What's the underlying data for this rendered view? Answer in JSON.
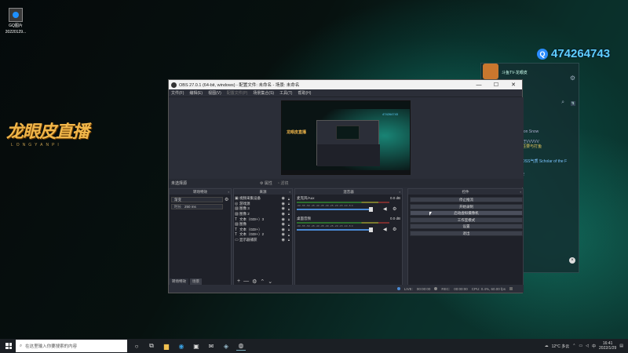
{
  "desktop": {
    "icon_label_line1": "GQ图片",
    "icon_label_line2": "20220129...",
    "logo_main": "龙眼皮直播",
    "logo_sub": "LONGYANPI",
    "qq_number": "474264743"
  },
  "chat_panel": {
    "title": "斗鱼TV-龙眼皮",
    "lines": [
      {
        "text": "...ron Snow",
        "style": "normal"
      },
      {
        "text": "...旺VVVVV",
        "style": "normal"
      },
      {
        "text": "...任要与打鱼",
        "style": "yellow"
      },
      {
        "text": "...DSS气质 Scholar of the F",
        "style": "blue"
      },
      {
        "text": "...2",
        "style": "normal"
      }
    ]
  },
  "obs": {
    "title": "OBS 27.0.1 (64-bit, windows) - 配置文件: 未命名 - 场景: 未命名",
    "menu": [
      {
        "label": "文件(F)",
        "dim": false
      },
      {
        "label": "编辑(E)",
        "dim": false
      },
      {
        "label": "视图(V)",
        "dim": false
      },
      {
        "label": "配置文件(P)",
        "dim": true
      },
      {
        "label": "场景集合(S)",
        "dim": false
      },
      {
        "label": "工具(T)",
        "dim": false
      },
      {
        "label": "帮助(H)",
        "dim": false
      }
    ],
    "source_bar_label": "未选择源",
    "properties_label": "属性",
    "filters_label": "滤镜",
    "docks": {
      "scenes_title": "转场特效",
      "sources_title": "来源",
      "mixer_title": "混音器",
      "controls_title": "控件"
    },
    "transition": {
      "value": "渐变",
      "duration_label": "时长",
      "duration_value": "250 ms"
    },
    "scene_tabs": [
      "转场特效",
      "场景"
    ],
    "sources": [
      {
        "icon": "monitor-icon",
        "glyph": "▣",
        "name": "视频采集设备"
      },
      {
        "icon": "game-icon",
        "glyph": "◎",
        "name": "游戏源"
      },
      {
        "icon": "image-icon",
        "glyph": "▨",
        "name": "图像 3"
      },
      {
        "icon": "image-icon",
        "glyph": "▨",
        "name": "图像 2"
      },
      {
        "icon": "text-icon",
        "glyph": "T",
        "name": "文本（GDI+）3"
      },
      {
        "icon": "image-icon",
        "glyph": "▨",
        "name": "图像"
      },
      {
        "icon": "text-icon",
        "glyph": "T",
        "name": "文本（GDI+）"
      },
      {
        "icon": "text-icon",
        "glyph": "T",
        "name": "文本（GDI+）2"
      },
      {
        "icon": "display-icon",
        "glyph": "▭",
        "name": "显示器捕获"
      }
    ],
    "mixer_tracks": [
      {
        "name": "麦克风/Aux",
        "db": "0.0 dB",
        "level": 0.9
      },
      {
        "name": "桌面音频",
        "db": "0.0 dB",
        "level": 0.9
      }
    ],
    "meter_ticks": "-60 -55 -50 -45 -40 -35 -30 -25 -20 -15 -10 -5 0",
    "controls": [
      {
        "label": "停止推流",
        "active": false
      },
      {
        "label": "开始录制",
        "active": false
      },
      {
        "label": "启动虚拟摄像机",
        "active": true
      },
      {
        "label": "工作室模式",
        "active": false
      },
      {
        "label": "设置",
        "active": false
      },
      {
        "label": "退出",
        "active": false
      }
    ],
    "status": {
      "live_label": "LIVE:",
      "live_time": "00:00:00",
      "rec_label": "REC:",
      "rec_time": "00:00:00",
      "cpu": "CPU: 0.4%, 60.00 fps"
    }
  },
  "taskbar": {
    "search_placeholder": "在这里输入你要搜索的内容",
    "weather": "12°C 多云",
    "time": "16:41",
    "date": "2022/1/29"
  },
  "colors": {
    "obs_bg": "#2b2e38",
    "accent_blue": "#4a8ad4",
    "logo_gold": "#f0b64a",
    "qq_blue": "#5fd0ff"
  }
}
